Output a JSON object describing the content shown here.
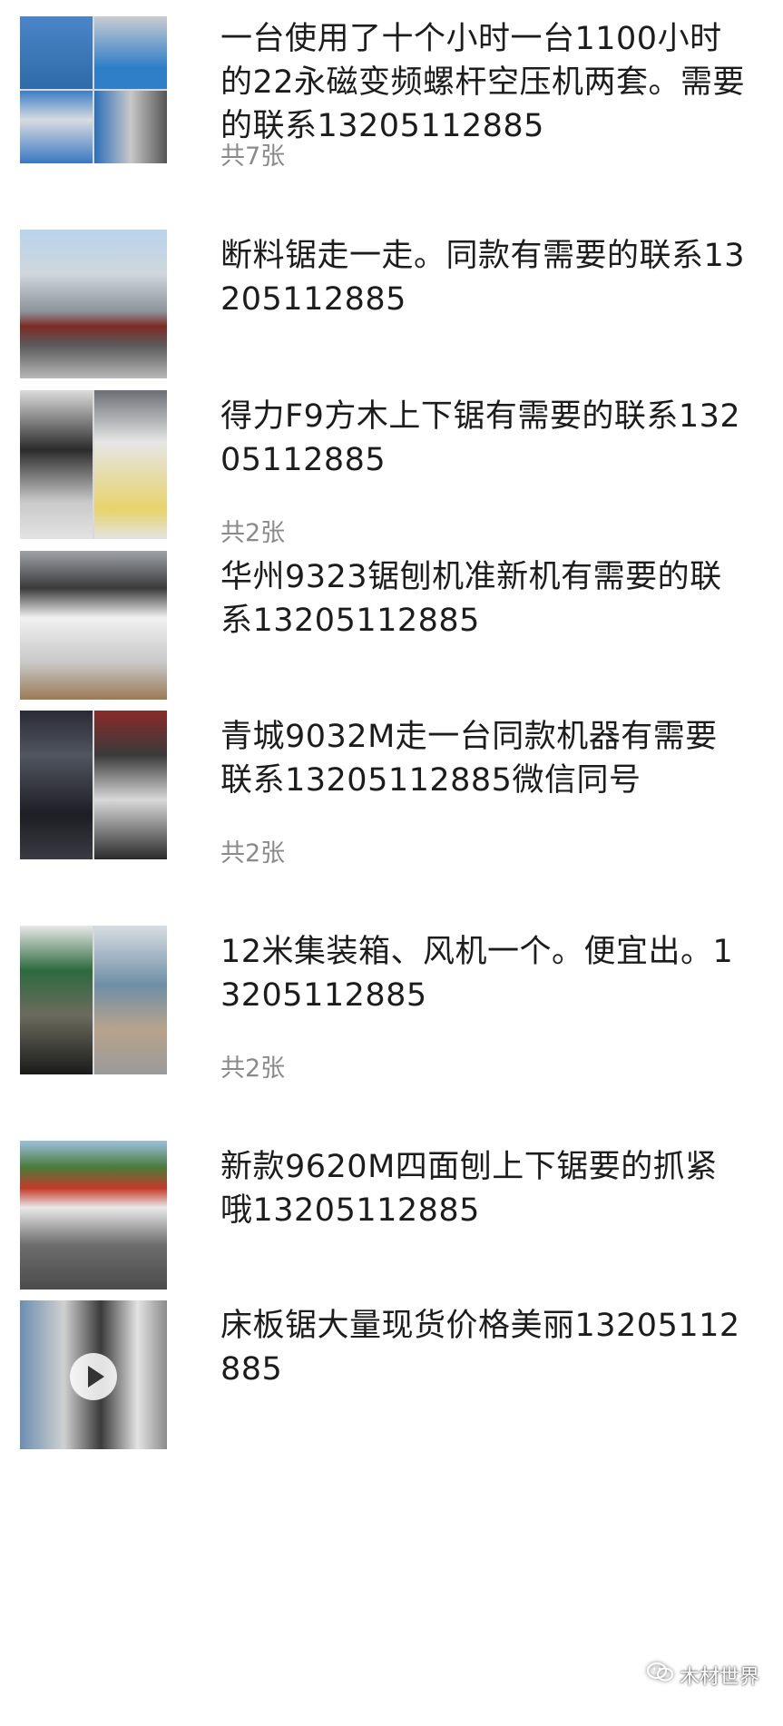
{
  "posts": [
    {
      "text": "一台使用了十个小时一台1100小时的22永磁变频螺杆空压机两套。需要的联系13205112885",
      "count": "共7张",
      "images": [
        "compressor-photo-1",
        "compressor-photo-2",
        "compressor-photo-3",
        "compressor-photo-4"
      ]
    },
    {
      "text": "断料锯走一走。同款有需要的联系13205112885",
      "count": "",
      "images": [
        "saw-on-truck-photo"
      ]
    },
    {
      "text": "得力F9方木上下锯有需要的联系13205112885",
      "count": "共2张",
      "images": [
        "nameplate-photo",
        "control-panel-photo"
      ]
    },
    {
      "text": "华州9323锯刨机准新机有需要的联系13205112885",
      "count": "",
      "images": [
        "planer-machine-photo"
      ]
    },
    {
      "text": "青城9032M走一台同款机器有需要联系13205112885微信同号",
      "count": "共2张",
      "images": [
        "spindle-photo-1",
        "spindle-photo-2"
      ]
    },
    {
      "text": "12米集装箱、风机一个。便宜出。13205112885",
      "count": "共2张",
      "images": [
        "fan-photo",
        "container-photo"
      ]
    },
    {
      "text": "新款9620M四面刨上下锯要的抓紧哦13205112885",
      "count": "",
      "images": [
        "four-side-planer-photo"
      ]
    },
    {
      "text": "床板锯大量现货价格美丽13205112885",
      "count": "",
      "images": [
        "bed-board-saw-video"
      ]
    }
  ],
  "watermark": {
    "label": "木材世界",
    "icon": "wechat-icon"
  }
}
